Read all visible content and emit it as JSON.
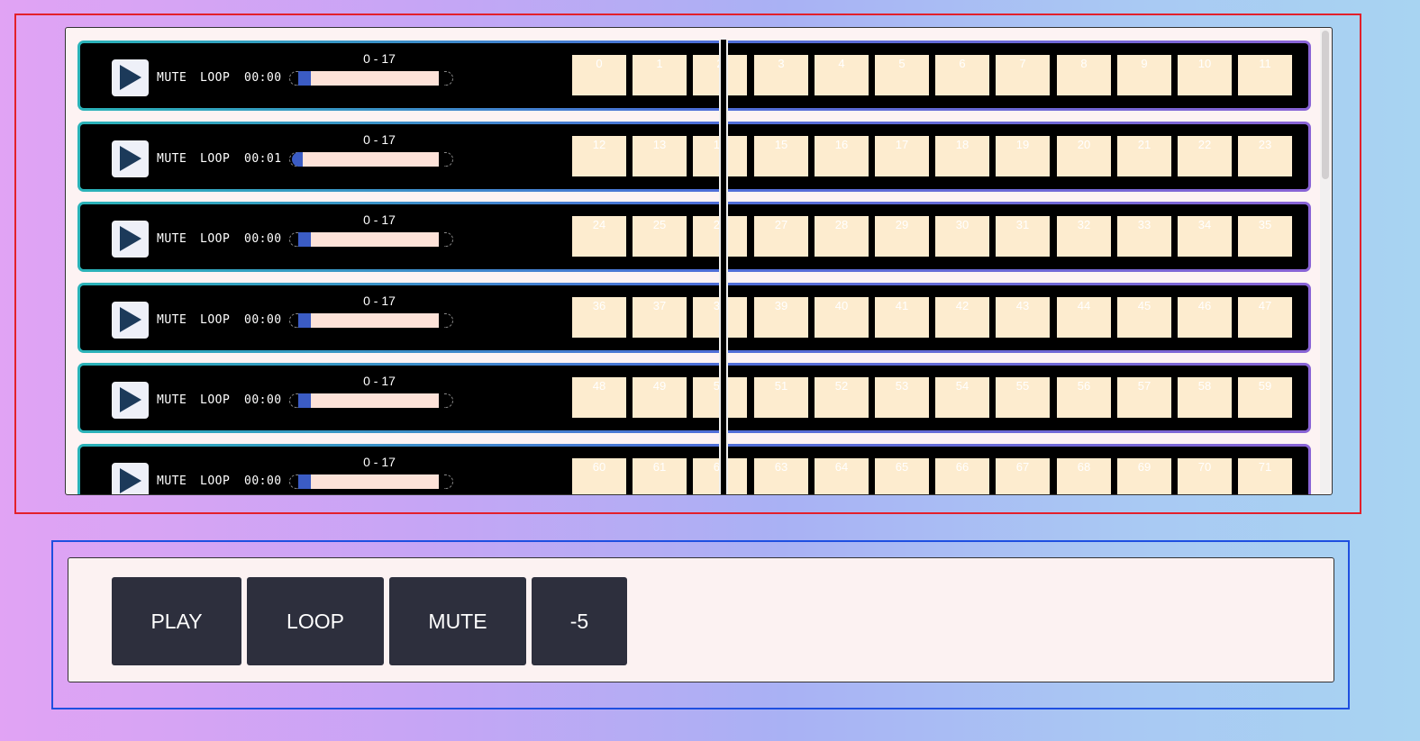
{
  "tracks": [
    {
      "range": "0 - 17",
      "mute": "MUTE",
      "loop": "LOOP",
      "time": "00:00",
      "progress": 0.05,
      "pads": [
        "0",
        "1",
        "2",
        "3",
        "4",
        "5",
        "6",
        "7",
        "8",
        "9",
        "10",
        "11"
      ]
    },
    {
      "range": "0 - 17",
      "mute": "MUTE",
      "loop": "LOOP",
      "time": "00:01",
      "progress": 0.0,
      "pads": [
        "12",
        "13",
        "14",
        "15",
        "16",
        "17",
        "18",
        "19",
        "20",
        "21",
        "22",
        "23"
      ]
    },
    {
      "range": "0 - 17",
      "mute": "MUTE",
      "loop": "LOOP",
      "time": "00:00",
      "progress": 0.05,
      "pads": [
        "24",
        "25",
        "26",
        "27",
        "28",
        "29",
        "30",
        "31",
        "32",
        "33",
        "34",
        "35"
      ]
    },
    {
      "range": "0 - 17",
      "mute": "MUTE",
      "loop": "LOOP",
      "time": "00:00",
      "progress": 0.05,
      "pads": [
        "36",
        "37",
        "38",
        "39",
        "40",
        "41",
        "42",
        "43",
        "44",
        "45",
        "46",
        "47"
      ]
    },
    {
      "range": "0 - 17",
      "mute": "MUTE",
      "loop": "LOOP",
      "time": "00:00",
      "progress": 0.05,
      "pads": [
        "48",
        "49",
        "50",
        "51",
        "52",
        "53",
        "54",
        "55",
        "56",
        "57",
        "58",
        "59"
      ]
    },
    {
      "range": "0 - 17",
      "mute": "MUTE",
      "loop": "LOOP",
      "time": "00:00",
      "progress": 0.05,
      "pads": [
        "60",
        "61",
        "62",
        "63",
        "64",
        "65",
        "66",
        "67",
        "68",
        "69",
        "70",
        "71"
      ]
    }
  ],
  "controls": {
    "play": "PLAY",
    "loop": "LOOP",
    "mute": "MUTE",
    "offset": "-5"
  },
  "colors": {
    "pad": "#fdeccf",
    "slider_fill": "#3b5cc4",
    "slider_rail": "#fde2d8",
    "button_bg": "#2d2f3d",
    "outline_top": "#e3202b",
    "outline_bottom": "#1e4fe0"
  },
  "icons": {
    "track_play": "play-triangle-icon"
  }
}
